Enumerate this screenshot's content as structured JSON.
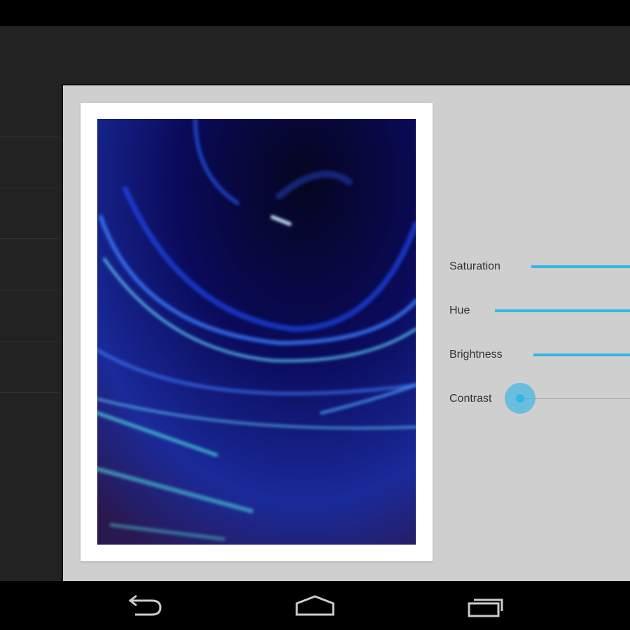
{
  "colors": {
    "accent": "#33b5e5",
    "panel": "#cfcfcf",
    "actionbar": "#222222"
  },
  "adjustments": [
    {
      "label": "Saturation"
    },
    {
      "label": "Hue"
    },
    {
      "label": "Brightness"
    },
    {
      "label": "Contrast",
      "value": 0
    }
  ],
  "navigation": {
    "icons": [
      "back-icon",
      "home-icon",
      "recent-apps-icon"
    ]
  }
}
